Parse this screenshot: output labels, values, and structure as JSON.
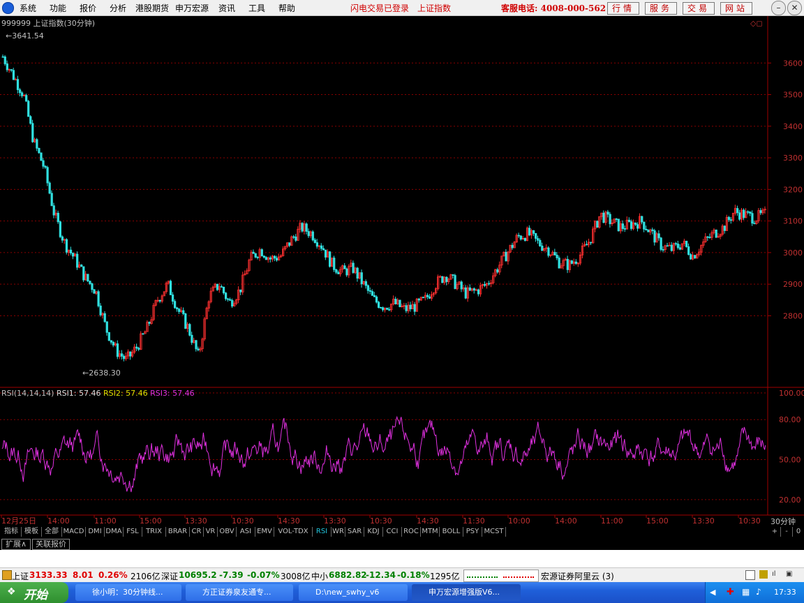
{
  "menubar": {
    "items": [
      "系统",
      "功能",
      "报价",
      "分析",
      "港股期货",
      "申万宏源",
      "资讯",
      "工具",
      "帮助"
    ],
    "status_login": "闪电交易已登录",
    "status_index": "上证指数",
    "hotline": "客服电话: 4008-000-562",
    "buttons": [
      "行情",
      "服务",
      "交易",
      "网站"
    ]
  },
  "main_chart": {
    "header": "999999 上证指数(30分钟)",
    "max_label": "3641.54",
    "min_label": "2638.30",
    "y_ticks": [
      "3600",
      "3500",
      "3400",
      "3300",
      "3200",
      "3100",
      "3000",
      "2900",
      "2800"
    ]
  },
  "rsi_panel": {
    "name": "RSI(14,14,14)",
    "rsi1": "RSI1: 57.46",
    "rsi2": "RSI2: 57.46",
    "rsi3": "RSI3: 57.46",
    "y_ticks": [
      "100.00",
      "80.00",
      "50.00",
      "20.00"
    ]
  },
  "x_axis": {
    "labels": [
      "12月25日",
      "14:00",
      "11:00",
      "15:00",
      "13:30",
      "10:30",
      "14:30",
      "13:30",
      "10:30",
      "14:30",
      "11:30",
      "10:00",
      "14:00",
      "11:00",
      "15:00",
      "13:30",
      "10:30"
    ],
    "period": "30分钟"
  },
  "tabs": {
    "left": [
      "指标",
      "模板",
      "全部"
    ],
    "indicators": [
      "MACD",
      "DMI",
      "DMA",
      "FSL",
      "TRIX",
      "BRAR",
      "CR",
      "VR",
      "OBV",
      "ASI",
      "EMV",
      "VOL-TDX",
      "RSI",
      "WR",
      "SAR",
      "KDJ",
      "CCI",
      "ROC",
      "MTM",
      "BOLL",
      "PSY",
      "MCST"
    ],
    "active": "RSI",
    "right": [
      "+",
      "-",
      "0"
    ]
  },
  "subtabs": [
    "扩展∧",
    "关联报价"
  ],
  "statusbar": {
    "sh_label": "上证",
    "sh_value": "3133.33",
    "sh_change": "8.01",
    "sh_pct": "0.26%",
    "sh_amount": "2106亿",
    "sz_label": "深证",
    "sz_value": "10695.2",
    "sz_change": "-7.39",
    "sz_pct": "-0.07%",
    "sz_amount": "3008亿",
    "zx_label": "中小",
    "zx_value": "6882.82",
    "zx_change": "-12.34",
    "zx_pct": "-0.18%",
    "zx_amount": "1295亿",
    "server": "宏源证券阿里云 (3)"
  },
  "taskbar": {
    "start": "开始",
    "tasks": [
      "徐小明：30分钟线...",
      "方正证券泉友通专...",
      "D:\\new_swhy_v6",
      "申万宏源增强版V6..."
    ],
    "clock": "17:33"
  },
  "chart_data": [
    {
      "type": "candlestick",
      "title": "999999 上证指数(30分钟)",
      "ylim": [
        2600,
        3700
      ],
      "key_points": [
        {
          "x": "start",
          "y": 3641.54
        },
        {
          "x": "low",
          "y": 2638.3
        },
        {
          "x": "end",
          "y": 3133.33
        }
      ],
      "path_approx": [
        3620,
        3560,
        3500,
        3350,
        3270,
        3120,
        3030,
        2980,
        2920,
        2880,
        2760,
        2690,
        2660,
        2700,
        2760,
        2850,
        2900,
        2820,
        2760,
        2670,
        2860,
        2900,
        2840,
        2880,
        2980,
        3010,
        2980,
        2990,
        3040,
        3080,
        3060,
        3020,
        2960,
        2940,
        2950,
        2900,
        2850,
        2830,
        2840,
        2820,
        2830,
        2850,
        2900,
        2930,
        2900,
        2870,
        2880,
        2900,
        2950,
        3000,
        3050,
        3060,
        3030,
        3010,
        2970,
        2960,
        2990,
        3040,
        3120,
        3100,
        3080,
        3090,
        3100,
        3060,
        3020,
        3010,
        3030,
        2990,
        3030,
        3060,
        3080,
        3130,
        3120,
        3110,
        3120
      ]
    },
    {
      "type": "line",
      "title": "RSI(14,14,14)",
      "ylim": [
        10,
        100
      ],
      "series": [
        {
          "name": "RSI1",
          "last": 57.46
        }
      ]
    }
  ]
}
